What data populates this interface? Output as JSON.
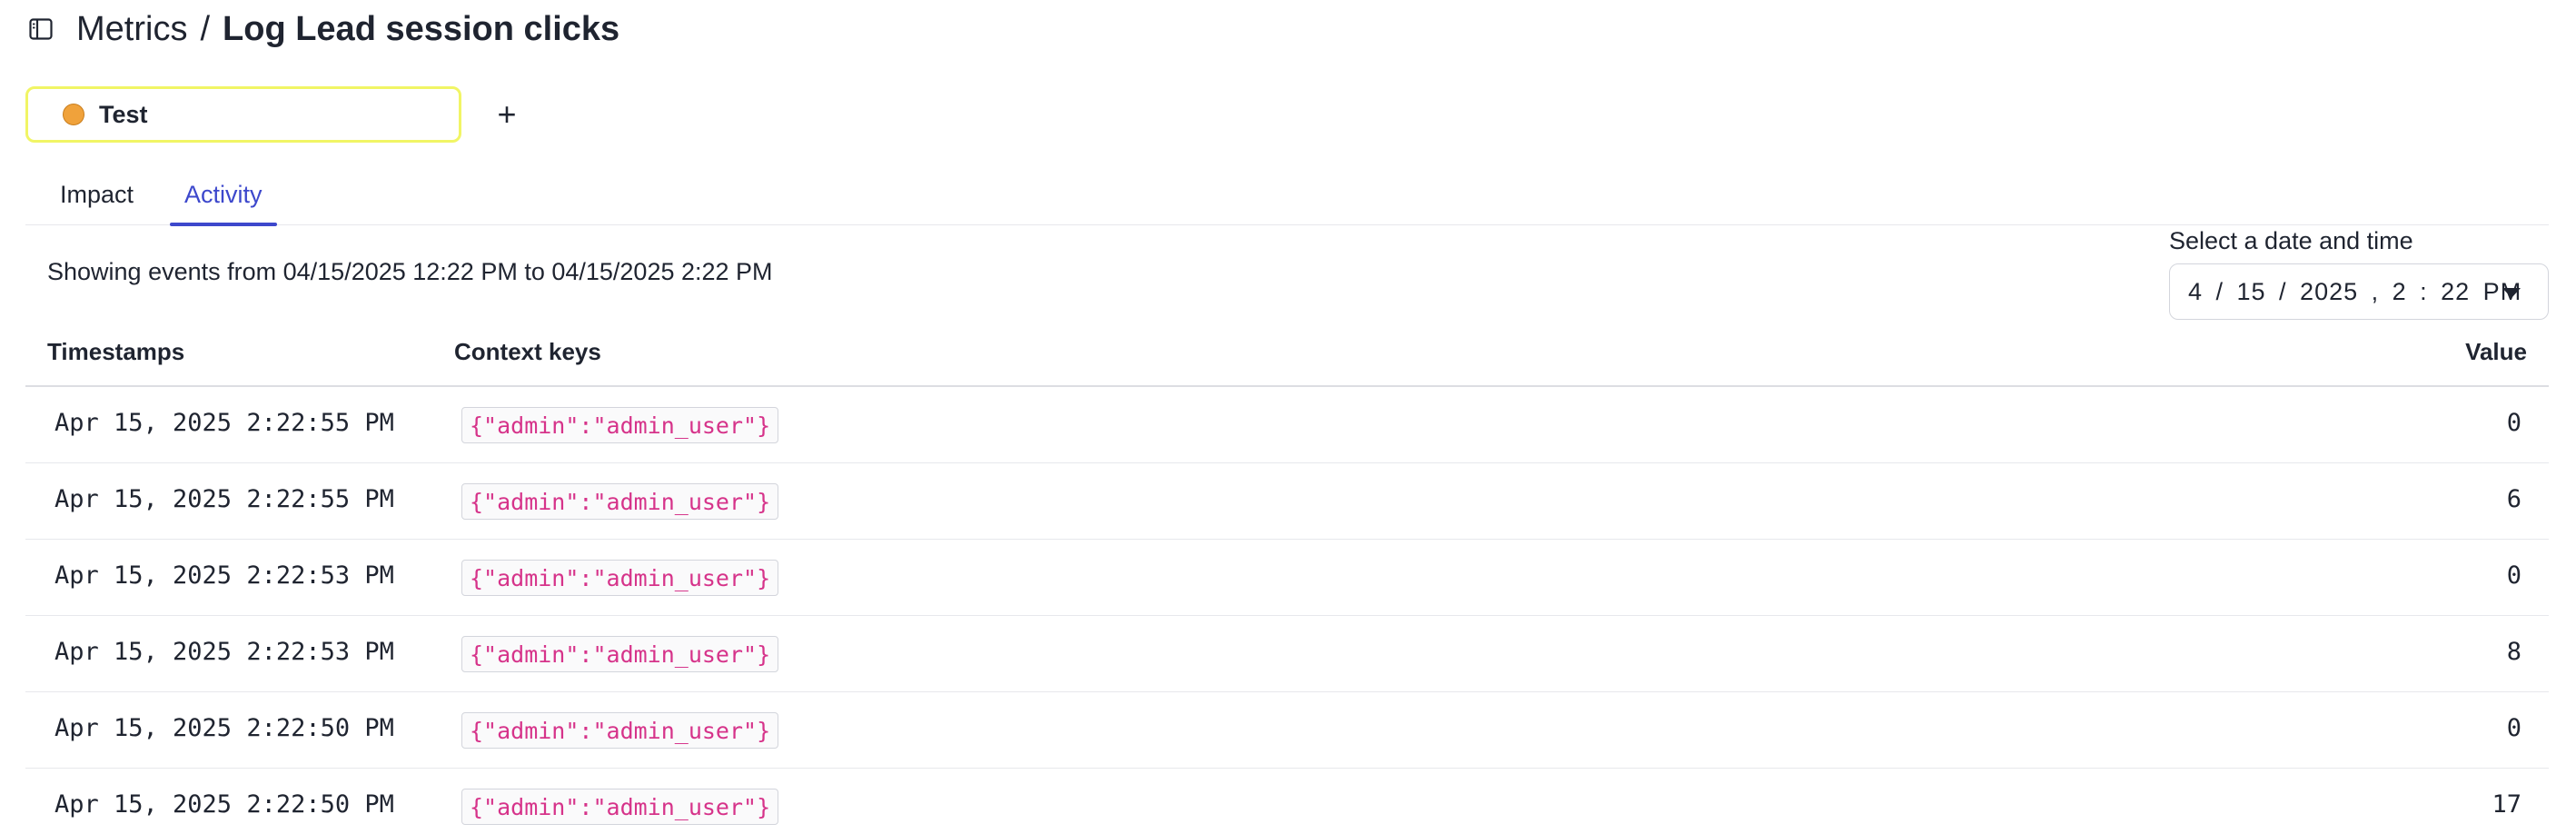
{
  "header": {
    "breadcrumb_root": "Metrics",
    "separator": "/",
    "title": "Log Lead session clicks"
  },
  "variation": {
    "label": "Test",
    "dot_color": "#f0a23b",
    "border_color": "#f1f565",
    "add_label": "+"
  },
  "tabs": [
    {
      "label": "Impact",
      "active": false
    },
    {
      "label": "Activity",
      "active": true
    }
  ],
  "activity": {
    "range_text": "Showing events from 04/15/2025 12:22 PM to 04/15/2025 2:22 PM",
    "date_picker": {
      "label": "Select a date and time",
      "value": "4 / 15 / 2025 , 2 : 22 PM"
    },
    "table": {
      "columns": [
        "Timestamps",
        "Context keys",
        "Value"
      ],
      "rows": [
        {
          "timestamp": "Apr 15, 2025 2:22:55 PM",
          "context": "{\"admin\":\"admin_user\"}",
          "value": "0"
        },
        {
          "timestamp": "Apr 15, 2025 2:22:55 PM",
          "context": "{\"admin\":\"admin_user\"}",
          "value": "6"
        },
        {
          "timestamp": "Apr 15, 2025 2:22:53 PM",
          "context": "{\"admin\":\"admin_user\"}",
          "value": "0"
        },
        {
          "timestamp": "Apr 15, 2025 2:22:53 PM",
          "context": "{\"admin\":\"admin_user\"}",
          "value": "8"
        },
        {
          "timestamp": "Apr 15, 2025 2:22:50 PM",
          "context": "{\"admin\":\"admin_user\"}",
          "value": "0"
        },
        {
          "timestamp": "Apr 15, 2025 2:22:50 PM",
          "context": "{\"admin\":\"admin_user\"}",
          "value": "17"
        }
      ]
    }
  },
  "colors": {
    "accent": "#3d48cc",
    "context_key_text": "#d6338a"
  },
  "icons": {
    "sidebar_toggle": "sidebar-toggle-icon",
    "date_dropdown": "caret-down-icon"
  }
}
